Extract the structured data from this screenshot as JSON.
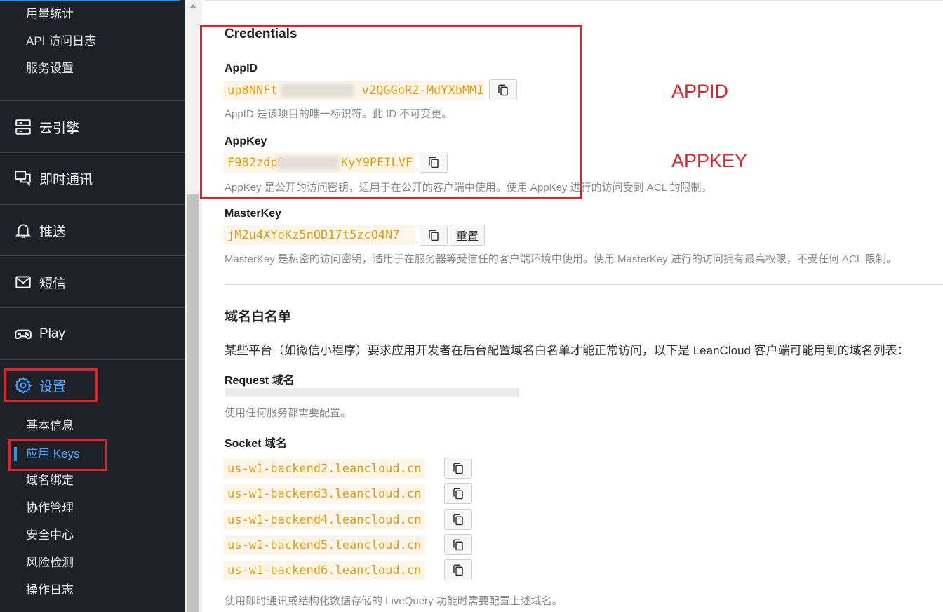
{
  "sidebar": {
    "top_items": [
      "用量统计",
      "API 访问日志",
      "服务设置"
    ],
    "nav": [
      {
        "label": "云引擎",
        "icon": "server-icon"
      },
      {
        "label": "即时通讯",
        "icon": "chat-icon"
      },
      {
        "label": "推送",
        "icon": "bell-icon"
      },
      {
        "label": "短信",
        "icon": "mail-icon"
      },
      {
        "label": "Play",
        "icon": "gamepad-icon"
      },
      {
        "label": "设置",
        "icon": "gear-icon"
      }
    ],
    "settings_items": [
      "基本信息",
      "应用 Keys",
      "域名绑定",
      "协作管理",
      "安全中心",
      "风险检测",
      "操作日志"
    ],
    "active_item": "应用 Keys"
  },
  "credentials": {
    "title": "Credentials",
    "appid": {
      "label": "AppID",
      "value_start": "up8NNFt",
      "value_end": "v2QGGoR2-MdYXbMMI",
      "help": "AppID 是该项目的唯一标识符。此 ID 不可变更。"
    },
    "appkey": {
      "label": "AppKey",
      "value_start": "F982zdpD",
      "value_end": "KyY9PEILVF",
      "help": "AppKey 是公开的访问密钥，适用于在公开的客户端中使用。使用 AppKey 进行的访问受到 ACL 的限制。"
    },
    "masterkey": {
      "label": "MasterKey",
      "value": "jM2u4XYoKz5nOD17t5zcO4N7",
      "reset_label": "重置",
      "help": "MasterKey 是私密的访问密钥，适用于在服务器等受信任的客户端环境中使用。使用 MasterKey 进行的访问拥有最高权限，不受任何 ACL 限制。"
    }
  },
  "whitelist": {
    "title": "域名白名单",
    "desc": "某些平台（如微信小程序）要求应用开发者在后台配置域名白名单才能正常访问，以下是 LeanCloud 客户端可能用到的域名列表：",
    "request_label": "Request 域名",
    "request_help": "使用任何服务都需要配置。",
    "socket_label": "Socket 域名",
    "socket_domains": [
      "us-w1-backend2.leancloud.cn",
      "us-w1-backend3.leancloud.cn",
      "us-w1-backend4.leancloud.cn",
      "us-w1-backend5.leancloud.cn",
      "us-w1-backend6.leancloud.cn"
    ],
    "socket_help": "使用即时通讯或结构化数据存储的 LiveQuery 功能时需要配置上述域名。"
  },
  "annotations": {
    "appid": "APPID",
    "appkey": "APPKEY"
  },
  "colors": {
    "sidebar_bg": "#1e2228",
    "accent": "#4aa3ff",
    "code_text": "#e49b12",
    "code_bg": "#fdf6e8",
    "annotation_red": "#e32128"
  }
}
